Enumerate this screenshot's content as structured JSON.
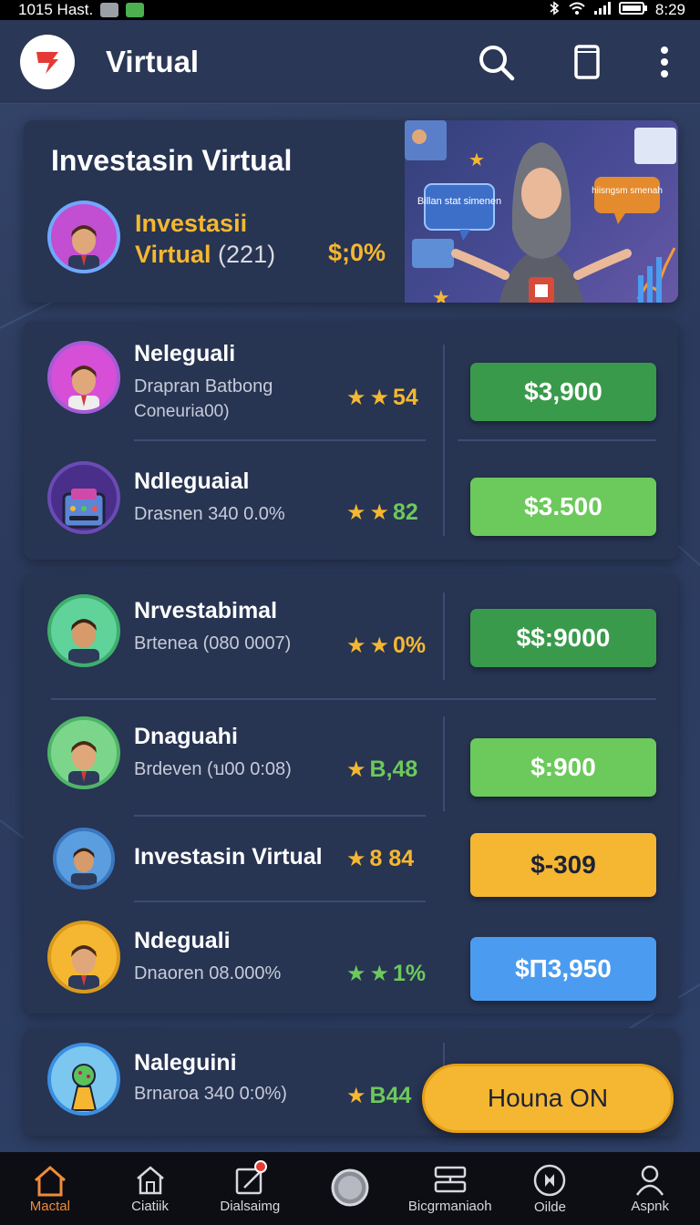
{
  "status_bar": {
    "time_left": "1015 Hast.",
    "time_right": "8:29"
  },
  "app_bar": {
    "title": "Virtual"
  },
  "hero": {
    "title": "Investasin Virtual",
    "name_line1": "Investasii",
    "name_line2": "Virtual",
    "count": "(221)",
    "percent": "$;0%",
    "bubble_left": "Billan stat simenen",
    "bubble_right": "hiisngsm smenah"
  },
  "card1": {
    "rows": [
      {
        "name": "Neleguali",
        "desc1": "Drapran Batbong",
        "desc2": "Coneuria00)",
        "rating": "54",
        "price": "$3,900"
      },
      {
        "name": "Ndleguaial",
        "desc1": "Drasnen 340 0.0%",
        "rating": "82",
        "price": "$3.500"
      }
    ]
  },
  "card2": {
    "rows": [
      {
        "name": "Nrvestabimal",
        "desc1": "Brtenea (080 0007)",
        "rating": "0%",
        "price": "$$:9000"
      },
      {
        "name": "Dnaguahi",
        "desc1": "Brdeven (บ00 0:08)",
        "rating": "B,48",
        "price": "$:900"
      },
      {
        "name": "Investasin Virtual",
        "rating": "8 84",
        "price": "$-309"
      },
      {
        "name": "Ndeguali",
        "desc1": "Dnaoren 08.000%",
        "rating": "1%",
        "price": "$П3,950"
      }
    ]
  },
  "card3": {
    "rows": [
      {
        "name": "Naleguini",
        "desc1": "Brnaroa 340 0:0%)",
        "rating": "B44"
      }
    ]
  },
  "fab": {
    "label": "Houna ON"
  },
  "bottom_nav": [
    {
      "label": "Mactal"
    },
    {
      "label": "Ciatiik"
    },
    {
      "label": "Dialsaimg"
    },
    {
      "label": ""
    },
    {
      "label": "Bicgrmaniaoh"
    },
    {
      "label": "Oilde"
    },
    {
      "label": "Aspnk"
    }
  ],
  "colors": {
    "green_dark": "#3a9a4c",
    "green_light": "#6cc95b",
    "yellow": "#f5b731",
    "blue": "#4b9cf0",
    "accent_orange": "#f08b3a"
  }
}
